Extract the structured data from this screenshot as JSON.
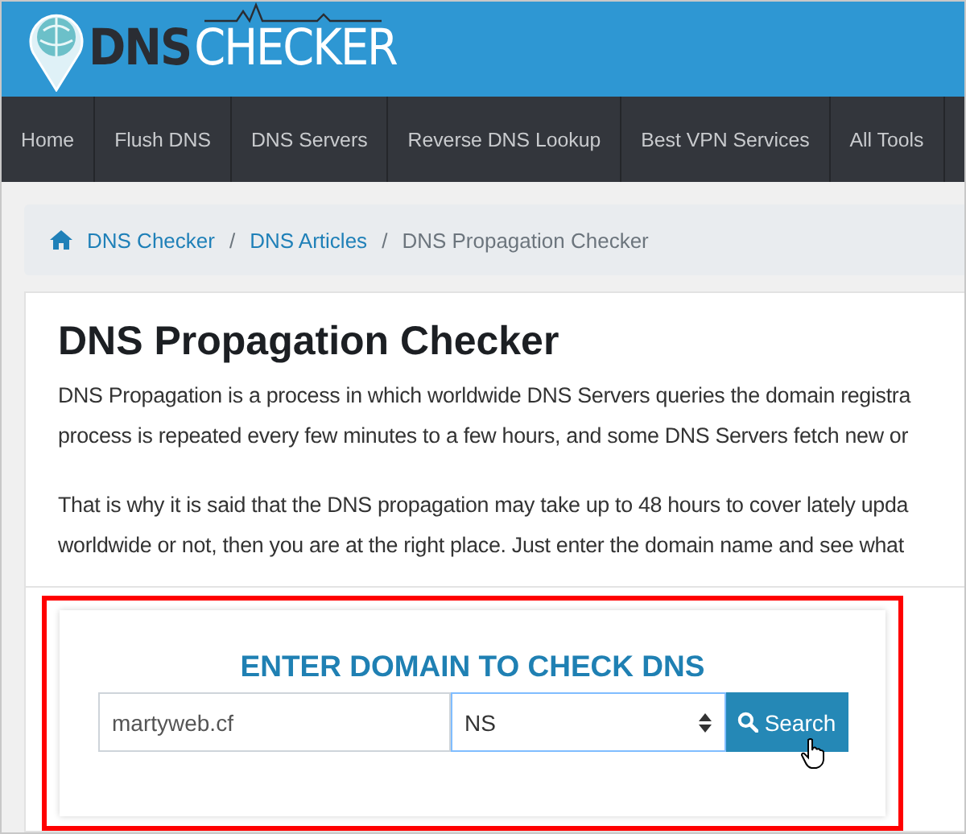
{
  "logo": {
    "prefix": "DNS",
    "suffix": "CHECKER"
  },
  "nav": [
    {
      "label": "Home"
    },
    {
      "label": "Flush DNS"
    },
    {
      "label": "DNS Servers"
    },
    {
      "label": "Reverse DNS Lookup"
    },
    {
      "label": "Best VPN Services"
    },
    {
      "label": "All Tools"
    }
  ],
  "breadcrumb_separator": "/",
  "breadcrumb": [
    {
      "label": "DNS Checker",
      "link": true
    },
    {
      "label": "DNS Articles",
      "link": true
    },
    {
      "label": "DNS Propagation Checker",
      "link": false
    }
  ],
  "article": {
    "title": "DNS Propagation Checker",
    "paragraphs": [
      [
        "DNS Propagation is a process in which worldwide DNS Servers queries the domain registra",
        "process is repeated every few minutes to a few hours, and some DNS Servers fetch new or"
      ],
      [
        "That is why it is said that the DNS propagation may take up to 48 hours to cover lately upda",
        "worldwide or not, then you are at the right place. Just enter the domain name and see what"
      ]
    ]
  },
  "search_form": {
    "heading": "ENTER DOMAIN TO CHECK DNS",
    "domain": {
      "value": "martyweb.cf"
    },
    "record_type": {
      "value": "NS"
    },
    "button": "Search",
    "highlighted": true
  }
}
